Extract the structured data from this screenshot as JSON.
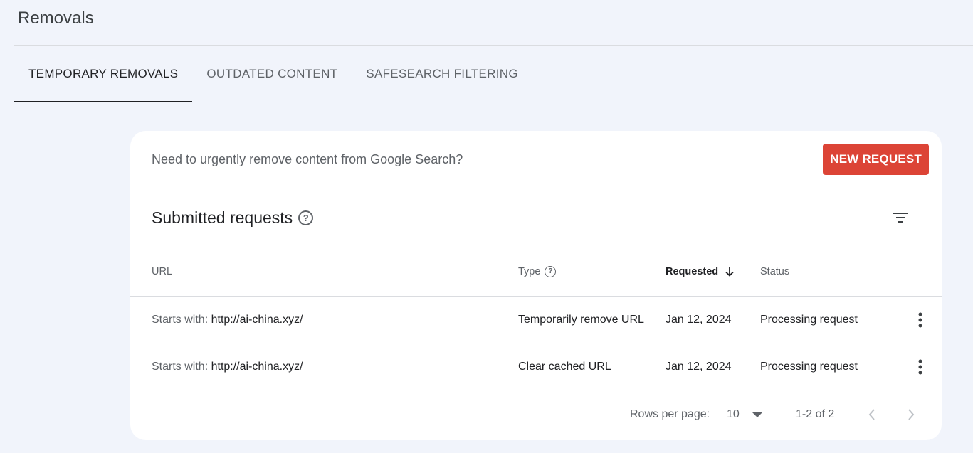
{
  "page": {
    "title": "Removals"
  },
  "tabs": [
    {
      "label": "TEMPORARY REMOVALS",
      "active": true
    },
    {
      "label": "OUTDATED CONTENT",
      "active": false
    },
    {
      "label": "SAFESEARCH FILTERING",
      "active": false
    }
  ],
  "banner": {
    "text": "Need to urgently remove content from Google Search?",
    "button_label": "NEW REQUEST",
    "button_color": "#dc4436"
  },
  "section": {
    "title": "Submitted requests",
    "help_icon": "help-icon",
    "filter_icon": "filter-icon"
  },
  "table": {
    "columns": {
      "url": "URL",
      "type": "Type",
      "requested": "Requested",
      "status": "Status"
    },
    "sort_icon": "arrow-down-icon",
    "rows": [
      {
        "url_prefix": "Starts with:",
        "url": "http://ai-china.xyz/",
        "type": "Temporarily remove URL",
        "requested": "Jan 12, 2024",
        "status": "Processing request"
      },
      {
        "url_prefix": "Starts with:",
        "url": "http://ai-china.xyz/",
        "type": "Clear cached URL",
        "requested": "Jan 12, 2024",
        "status": "Processing request"
      }
    ]
  },
  "pagination": {
    "rows_per_page_label": "Rows per page:",
    "rows_per_page_value": "10",
    "range": "1-2 of 2"
  }
}
